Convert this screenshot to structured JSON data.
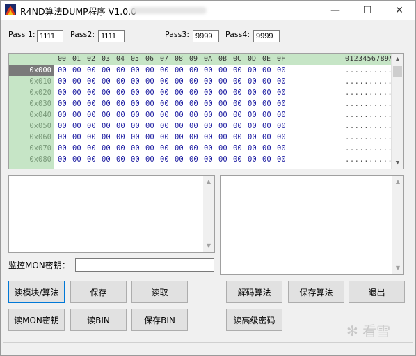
{
  "window": {
    "title": "R4ND算法DUMP程序 V1.0.0",
    "minimize_glyph": "—",
    "maximize_glyph": "☐",
    "close_glyph": "✕"
  },
  "passwords": [
    {
      "label": "Pass 1:",
      "value": "1111"
    },
    {
      "label": "Pass2:",
      "value": "1111"
    },
    {
      "label": "Pass3:",
      "value": "9999"
    },
    {
      "label": "Pass4:",
      "value": "9999"
    }
  ],
  "hexview": {
    "columns": [
      "00",
      "01",
      "02",
      "03",
      "04",
      "05",
      "06",
      "07",
      "08",
      "09",
      "0A",
      "0B",
      "0C",
      "0D",
      "0E",
      "0F"
    ],
    "ascii_header": "0123456789ABCDEF",
    "rows": [
      {
        "address": "0x000",
        "bytes": [
          "00",
          "00",
          "00",
          "00",
          "00",
          "00",
          "00",
          "00",
          "00",
          "00",
          "00",
          "00",
          "00",
          "00",
          "00",
          "00"
        ],
        "ascii": "................"
      },
      {
        "address": "0x010",
        "bytes": [
          "00",
          "00",
          "00",
          "00",
          "00",
          "00",
          "00",
          "00",
          "00",
          "00",
          "00",
          "00",
          "00",
          "00",
          "00",
          "00"
        ],
        "ascii": "................"
      },
      {
        "address": "0x020",
        "bytes": [
          "00",
          "00",
          "00",
          "00",
          "00",
          "00",
          "00",
          "00",
          "00",
          "00",
          "00",
          "00",
          "00",
          "00",
          "00",
          "00"
        ],
        "ascii": "................"
      },
      {
        "address": "0x030",
        "bytes": [
          "00",
          "00",
          "00",
          "00",
          "00",
          "00",
          "00",
          "00",
          "00",
          "00",
          "00",
          "00",
          "00",
          "00",
          "00",
          "00"
        ],
        "ascii": "................"
      },
      {
        "address": "0x040",
        "bytes": [
          "00",
          "00",
          "00",
          "00",
          "00",
          "00",
          "00",
          "00",
          "00",
          "00",
          "00",
          "00",
          "00",
          "00",
          "00",
          "00"
        ],
        "ascii": "................"
      },
      {
        "address": "0x050",
        "bytes": [
          "00",
          "00",
          "00",
          "00",
          "00",
          "00",
          "00",
          "00",
          "00",
          "00",
          "00",
          "00",
          "00",
          "00",
          "00",
          "00"
        ],
        "ascii": "................"
      },
      {
        "address": "0x060",
        "bytes": [
          "00",
          "00",
          "00",
          "00",
          "00",
          "00",
          "00",
          "00",
          "00",
          "00",
          "00",
          "00",
          "00",
          "00",
          "00",
          "00"
        ],
        "ascii": "................"
      },
      {
        "address": "0x070",
        "bytes": [
          "00",
          "00",
          "00",
          "00",
          "00",
          "00",
          "00",
          "00",
          "00",
          "00",
          "00",
          "00",
          "00",
          "00",
          "00",
          "00"
        ],
        "ascii": "................"
      },
      {
        "address": "0x080",
        "bytes": [
          "00",
          "00",
          "00",
          "00",
          "00",
          "00",
          "00",
          "00",
          "00",
          "00",
          "00",
          "00",
          "00",
          "00",
          "00",
          "00"
        ],
        "ascii": "................"
      }
    ],
    "selected_address": "0x000"
  },
  "monitor": {
    "label": "监控MON密钥：",
    "value": ""
  },
  "buttons": {
    "read_module": "读模块/算法",
    "save": "保存",
    "read": "读取",
    "decode_algo": "解码算法",
    "save_algo": "保存算法",
    "exit": "退出",
    "read_mon_key": "读MON密钥",
    "read_bin": "读BIN",
    "save_bin": "保存BIN",
    "read_adv_password": "读高级密码"
  },
  "watermark": "✻ 看雪",
  "colors": {
    "grid_header_bg": "#c6e5c6",
    "hex_text": "#1a1aa0",
    "selected_row_bg": "#7a7a7a",
    "focus_border": "#0078d7"
  }
}
